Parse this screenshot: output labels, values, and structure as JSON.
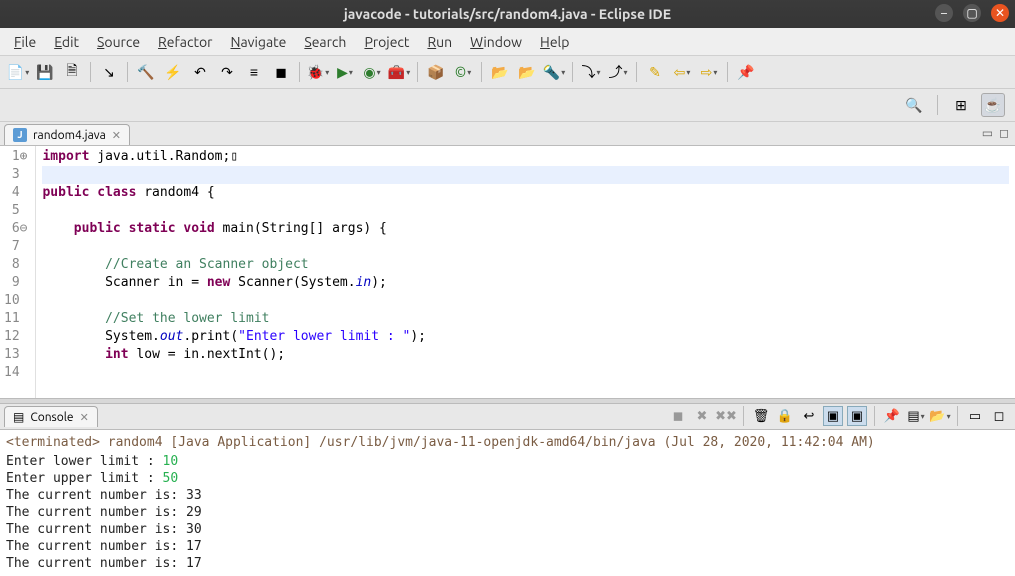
{
  "window": {
    "title": "javacode - tutorials/src/random4.java - Eclipse IDE"
  },
  "menu": [
    "File",
    "Edit",
    "Source",
    "Refactor",
    "Navigate",
    "Search",
    "Project",
    "Run",
    "Window",
    "Help"
  ],
  "editor": {
    "tab_label": "random4.java",
    "lines": [
      {
        "n": "1",
        "marker": "⊕",
        "html": "<span class='kw'>import</span> java.util.Random;▯"
      },
      {
        "n": "3",
        "marker": "",
        "html": ""
      },
      {
        "n": "4",
        "marker": "",
        "html": "<span class='kw'>public class</span> random4 {"
      },
      {
        "n": "5",
        "marker": "",
        "html": ""
      },
      {
        "n": "6",
        "marker": "⊖",
        "html": "    <span class='kw'>public static void</span> main(String[] args) {"
      },
      {
        "n": "7",
        "marker": "",
        "html": ""
      },
      {
        "n": "8",
        "marker": "",
        "html": "        <span class='cm'>//Create an Scanner object</span>"
      },
      {
        "n": "9",
        "marker": "",
        "html": "        Scanner in = <span class='kw'>new</span> Scanner(System.<span class='fld'>in</span>);"
      },
      {
        "n": "10",
        "marker": "",
        "html": ""
      },
      {
        "n": "11",
        "marker": "",
        "html": "        <span class='cm'>//Set the lower limit</span>"
      },
      {
        "n": "12",
        "marker": "",
        "html": "        System.<span class='fld'>out</span>.print(<span class='str'>\"Enter lower limit : \"</span>);"
      },
      {
        "n": "13",
        "marker": "",
        "html": "        <span class='kw'>int</span> low = in.nextInt();"
      },
      {
        "n": "14",
        "marker": "",
        "html": ""
      }
    ]
  },
  "console": {
    "tab_label": "Console",
    "status": "<terminated> random4 [Java Application] /usr/lib/jvm/java-11-openjdk-amd64/bin/java (Jul 28, 2020, 11:42:04 AM)",
    "lines": [
      {
        "text": "Enter lower limit : ",
        "suffix": "10",
        "suffixClass": "ansi-green"
      },
      {
        "text": "Enter upper limit : ",
        "suffix": "50",
        "suffixClass": "ansi-green"
      },
      {
        "text": "The current number is: 33"
      },
      {
        "text": "The current number is: 29"
      },
      {
        "text": "The current number is: 30"
      },
      {
        "text": "The current number is: 17"
      },
      {
        "text": "The current number is: 17"
      }
    ]
  }
}
